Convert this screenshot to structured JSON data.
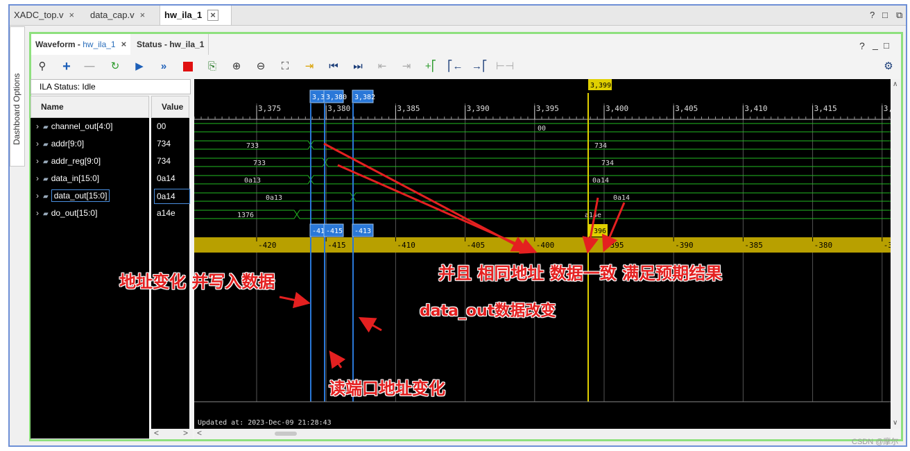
{
  "tabs": [
    {
      "label": "XADC_top.v"
    },
    {
      "label": "data_cap.v"
    },
    {
      "label": "hw_ila_1"
    }
  ],
  "window_controls": {
    "help": "?",
    "restore": "□",
    "maximize": "⧉"
  },
  "side_panel": {
    "label": "Dashboard Options"
  },
  "wave_tabs": {
    "waveform_label": "Waveform - ",
    "waveform_name": "hw_ila_1",
    "status_label": "Status - hw_ila_1"
  },
  "panel_controls": {
    "help": "?",
    "minimize": "_",
    "restore": "□"
  },
  "toolbar": {
    "icons": [
      "search-icon",
      "add-icon",
      "remove-icon",
      "run-trigger-immediate-icon",
      "run-trigger-icon",
      "run-continuous-icon",
      "stop-icon",
      "export-icon",
      "zoom-in-icon",
      "zoom-out-icon",
      "zoom-fit-icon",
      "go-to-cursor-icon",
      "go-to-start-icon",
      "go-to-end-icon",
      "previous-transition-icon",
      "next-transition-icon",
      "add-marker-icon",
      "previous-marker-icon",
      "next-marker-icon",
      "swap-cursors-icon",
      "settings-gear-icon"
    ]
  },
  "ila_status": "ILA Status:  Idle",
  "columns": {
    "name": "Name",
    "value": "Value"
  },
  "signals": [
    {
      "name": "channel_out[4:0]",
      "value": "00"
    },
    {
      "name": "addr[9:0]",
      "value": "734"
    },
    {
      "name": "addr_reg[9:0]",
      "value": "734"
    },
    {
      "name": "data_in[15:0]",
      "value": "0a14"
    },
    {
      "name": "data_out[15:0]",
      "value": "0a14"
    },
    {
      "name": "do_out[15:0]",
      "value": "a14e"
    }
  ],
  "time_axis": {
    "labels": [
      "3,375",
      "3,380",
      "3,385",
      "3,390",
      "3,395",
      "3,400",
      "3,405",
      "3,410",
      "3,415",
      "3,4"
    ]
  },
  "markers": {
    "m1": "3,3",
    "m2": "3,380",
    "m3": "3,382",
    "cursor": "3,399"
  },
  "wave_values": {
    "ch": "00",
    "addr_a": "733",
    "addr_b": "734",
    "addrreg_a": "733",
    "addrreg_b": "734",
    "din_a": "0a13",
    "din_b": "0a14",
    "dout_a": "0a13",
    "dout_b": "0a14",
    "doout_a": "1376",
    "doout_b": "a14e"
  },
  "rel_axis": {
    "labels": [
      "-420",
      "-415",
      "-410",
      "-405",
      "-400",
      "-395",
      "-390",
      "-385",
      "-380",
      "-3"
    ],
    "m1": "-41",
    "m2": "-415",
    "m3": "-413",
    "cursor": "-396"
  },
  "updated": "Updated at: 2023-Dec-09 21:28:43",
  "annotations": {
    "a1": "地址变化 并写入数据",
    "a2": "并且  相同地址  数据一致 满足预期结果",
    "a3": "data_out数据改变",
    "a4": "读端口地址变化"
  },
  "watermark": "CSDN @摩尔",
  "colors": {
    "trace": "#22bb22",
    "marker": "#2a78d8",
    "cursor": "#e0d000",
    "axis_bar": "#b8a000",
    "annotation": "#e42020"
  }
}
